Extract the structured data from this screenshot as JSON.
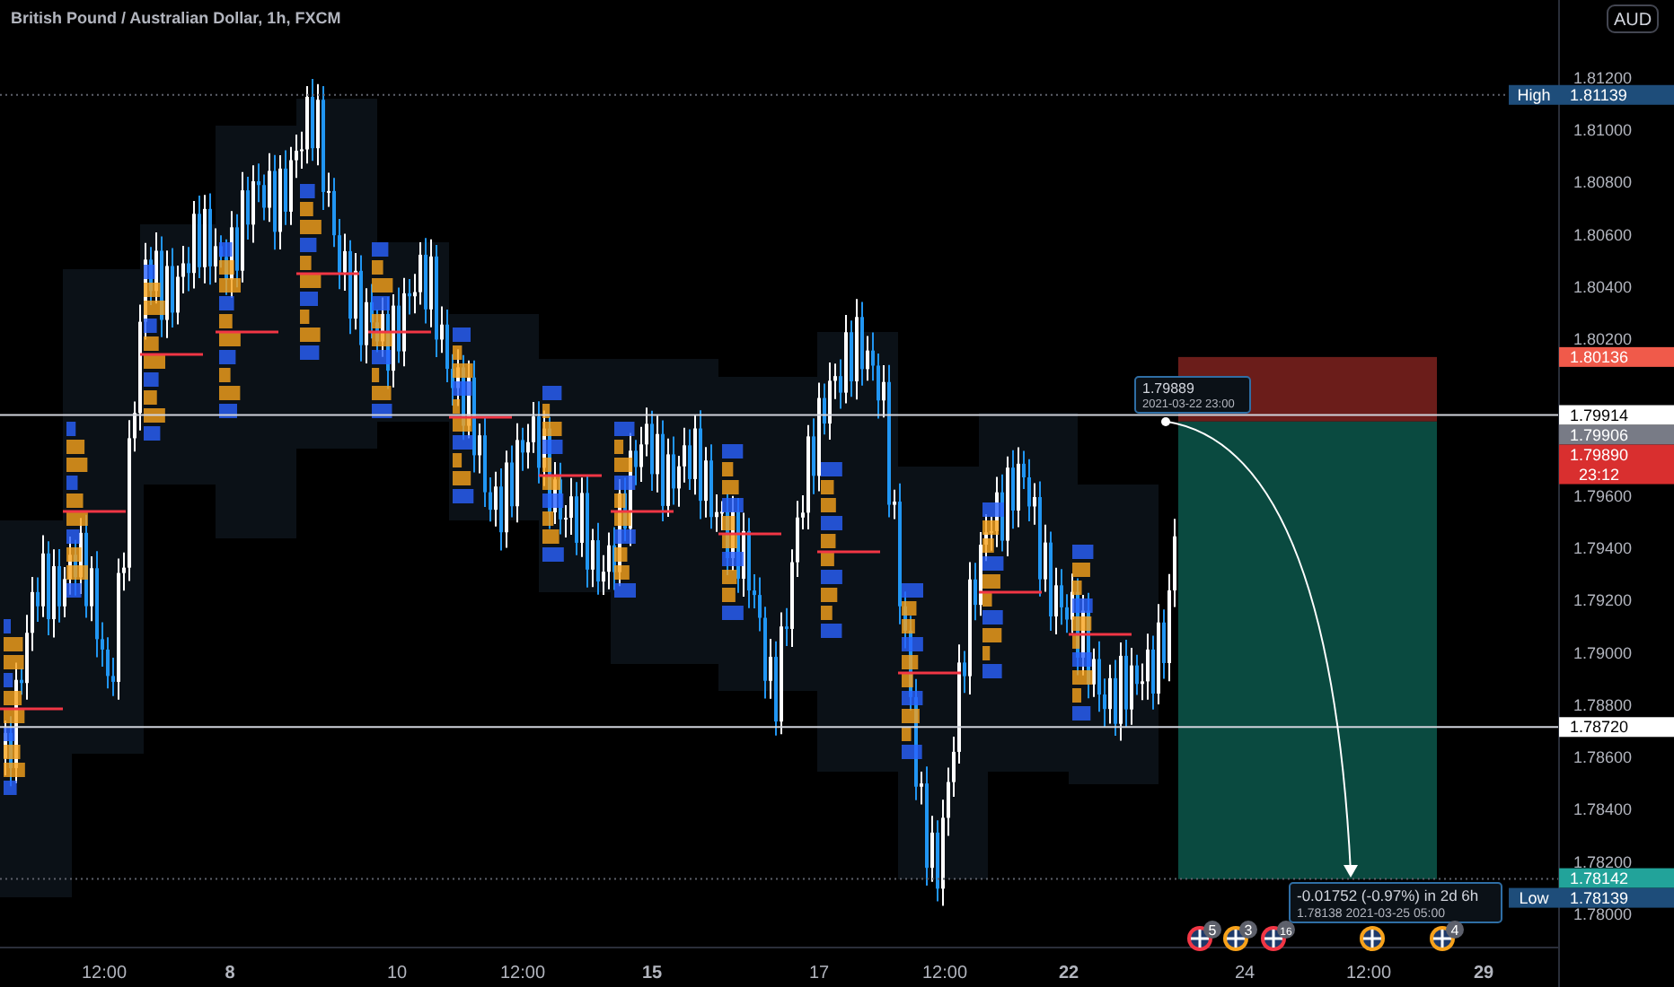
{
  "header": {
    "title": "British Pound / Australian Dollar, 1h, FXCM"
  },
  "price_axis": {
    "currency": "AUD",
    "ticks": [
      "1.81200",
      "1.81000",
      "1.80800",
      "1.80600",
      "1.80400",
      "1.80200",
      "1.79600",
      "1.79400",
      "1.79200",
      "1.79000",
      "1.78800",
      "1.78600",
      "1.78400",
      "1.78200",
      "1.78000"
    ]
  },
  "price_labels": [
    {
      "kind": "high",
      "tag": "High",
      "price": "1.81139"
    },
    {
      "kind": "stop",
      "price": "1.80136"
    },
    {
      "kind": "line",
      "price": "1.79914"
    },
    {
      "kind": "previous",
      "price": "1.79906"
    },
    {
      "kind": "last",
      "price": "1.79890",
      "countdown": "23:12"
    },
    {
      "kind": "line",
      "price": "1.78720"
    },
    {
      "kind": "target",
      "price": "1.78142"
    },
    {
      "kind": "low",
      "tag": "Low",
      "price": "1.78139"
    }
  ],
  "time_axis": {
    "ticks": [
      {
        "label": "12:00",
        "bold": false
      },
      {
        "label": "8",
        "bold": true
      },
      {
        "label": "10",
        "bold": false
      },
      {
        "label": "12:00",
        "bold": false
      },
      {
        "label": "15",
        "bold": true
      },
      {
        "label": "17",
        "bold": false
      },
      {
        "label": "12:00",
        "bold": false
      },
      {
        "label": "22",
        "bold": true
      },
      {
        "label": "24",
        "bold": false
      },
      {
        "label": "12:00",
        "bold": false
      },
      {
        "label": "29",
        "bold": true
      }
    ]
  },
  "position": {
    "entry": {
      "price": "1.79889",
      "time": "2021-03-22 23:00"
    },
    "target": {
      "change": "-0.01752 (-0.97%) in 2d 6h",
      "price": "1.78138",
      "time": "2021-03-25  05:00"
    }
  },
  "events": [
    {
      "count": "5",
      "color": "#f23645"
    },
    {
      "count": "3",
      "color": "#f7a21b"
    },
    {
      "count": "16",
      "color": "#f23645"
    },
    {
      "color": "#f7a21b"
    },
    {
      "count": "4",
      "color": "#f7a21b"
    }
  ]
}
